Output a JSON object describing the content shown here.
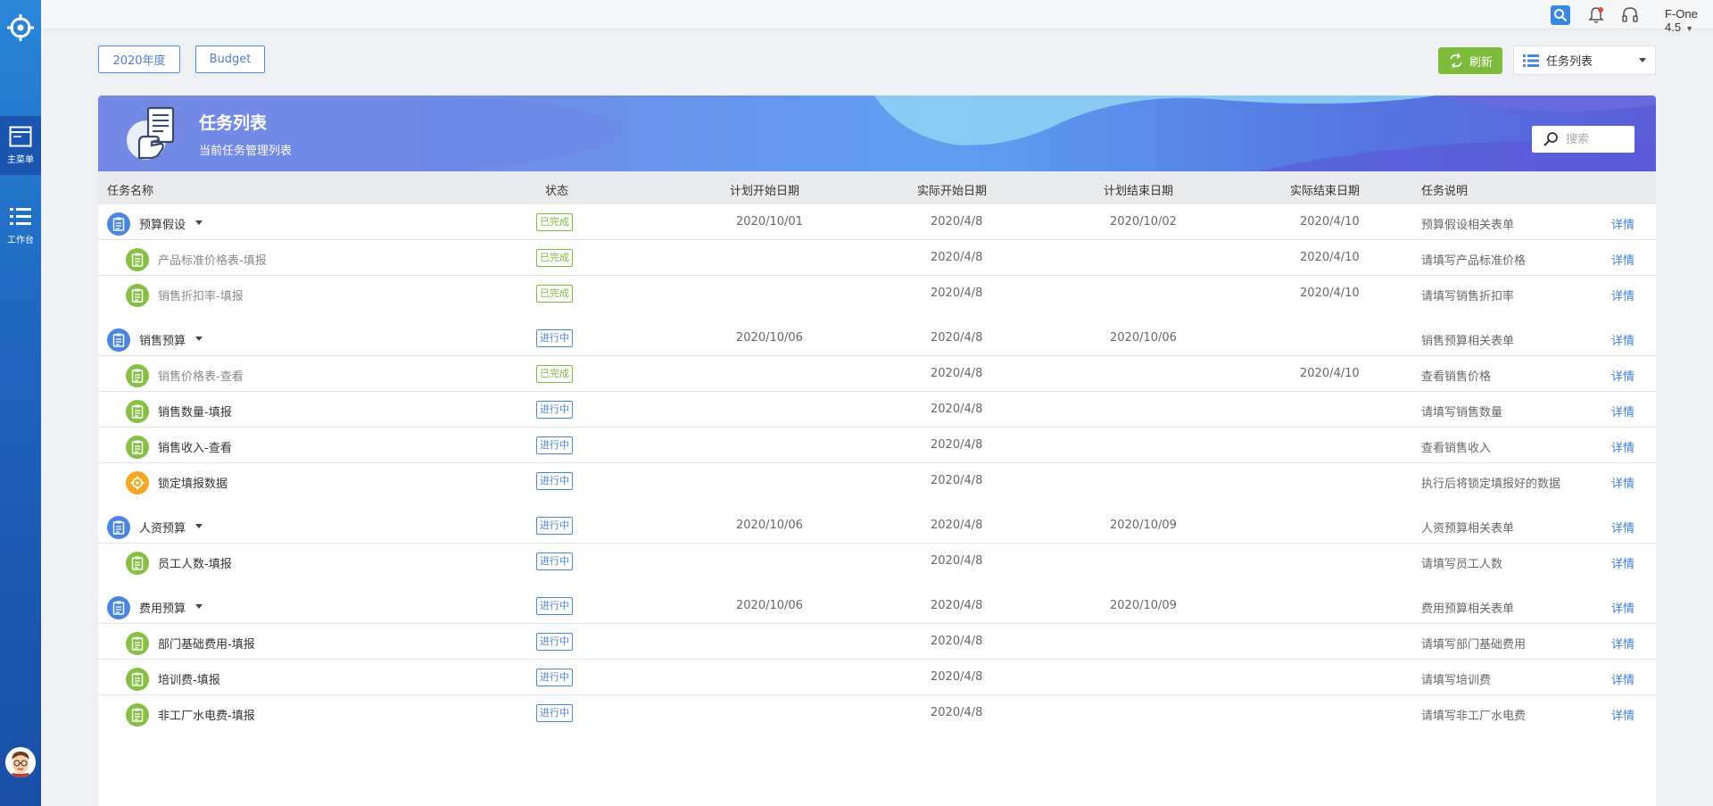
{
  "sidebar": {
    "main_menu_label": "主菜单",
    "workbench_label": "工作台"
  },
  "topbar": {
    "user": "F-One 4.5"
  },
  "filters": {
    "year": "2020年度",
    "scenario": "Budget"
  },
  "actions": {
    "refresh": "刷新",
    "view": "任务列表"
  },
  "banner": {
    "title": "任务列表",
    "subtitle": "当前任务管理列表",
    "search_placeholder": "搜索"
  },
  "table": {
    "headers": [
      "任务名称",
      "状态",
      "计划开始日期",
      "实际开始日期",
      "计划结束日期",
      "实际结束日期",
      "任务说明"
    ],
    "detail": "详情",
    "groups": [
      {
        "rows": [
          {
            "name": "预算假设",
            "status": "已完成",
            "plan_start": "2020/10/01",
            "actual_start": "2020/4/8",
            "plan_end": "2020/10/02",
            "actual_end": "2020/4/10",
            "desc": "预算假设相关表单"
          },
          {
            "name": "产品标准价格表-填报",
            "status": "已完成",
            "plan_start": "",
            "actual_start": "2020/4/8",
            "plan_end": "",
            "actual_end": "2020/4/10",
            "desc": "请填写产品标准价格"
          },
          {
            "name": "销售折扣率-填报",
            "status": "已完成",
            "plan_start": "",
            "actual_start": "2020/4/8",
            "plan_end": "",
            "actual_end": "2020/4/10",
            "desc": "请填写销售折扣率"
          }
        ]
      },
      {
        "rows": [
          {
            "name": "销售预算",
            "status": "进行中",
            "plan_start": "2020/10/06",
            "actual_start": "2020/4/8",
            "plan_end": "2020/10/06",
            "actual_end": "",
            "desc": "销售预算相关表单"
          },
          {
            "name": "销售价格表-查看",
            "status": "已完成",
            "plan_start": "",
            "actual_start": "2020/4/8",
            "plan_end": "",
            "actual_end": "2020/4/10",
            "desc": "查看销售价格"
          },
          {
            "name": "销售数量-填报",
            "status": "进行中",
            "plan_start": "",
            "actual_start": "2020/4/8",
            "plan_end": "",
            "actual_end": "",
            "desc": "请填写销售数量"
          },
          {
            "name": "销售收入-查看",
            "status": "进行中",
            "plan_start": "",
            "actual_start": "2020/4/8",
            "plan_end": "",
            "actual_end": "",
            "desc": "查看销售收入"
          },
          {
            "name": "锁定填报数据",
            "status": "进行中",
            "plan_start": "",
            "actual_start": "2020/4/8",
            "plan_end": "",
            "actual_end": "",
            "desc": "执行后将锁定填报好的数据"
          }
        ]
      },
      {
        "rows": [
          {
            "name": "人资预算",
            "status": "进行中",
            "plan_start": "2020/10/06",
            "actual_start": "2020/4/8",
            "plan_end": "2020/10/09",
            "actual_end": "",
            "desc": "人资预算相关表单"
          },
          {
            "name": "员工人数-填报",
            "status": "进行中",
            "plan_start": "",
            "actual_start": "2020/4/8",
            "plan_end": "",
            "actual_end": "",
            "desc": "请填写员工人数"
          }
        ]
      },
      {
        "rows": [
          {
            "name": "费用预算",
            "status": "进行中",
            "plan_start": "2020/10/06",
            "actual_start": "2020/4/8",
            "plan_end": "2020/10/09",
            "actual_end": "",
            "desc": "费用预算相关表单"
          },
          {
            "name": "部门基础费用-填报",
            "status": "进行中",
            "plan_start": "",
            "actual_start": "2020/4/8",
            "plan_end": "",
            "actual_end": "",
            "desc": "请填写部门基础费用"
          },
          {
            "name": "培训费-填报",
            "status": "进行中",
            "plan_start": "",
            "actual_start": "2020/4/8",
            "plan_end": "",
            "actual_end": "",
            "desc": "请填写培训费"
          },
          {
            "name": "非工厂水电费-填报",
            "status": "进行中",
            "plan_start": "",
            "actual_start": "2020/4/8",
            "plan_end": "",
            "actual_end": "",
            "desc": "请填写非工厂水电费"
          }
        ]
      }
    ]
  }
}
